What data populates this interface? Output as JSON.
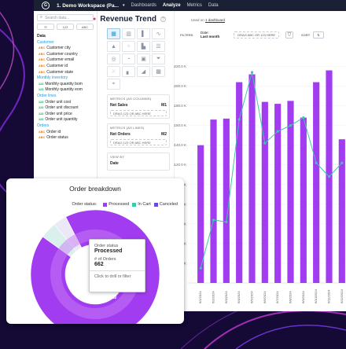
{
  "topbar": {
    "workspace": "1. Demo Workspace (Pa...",
    "nav": [
      "Dashboards",
      "Analyze",
      "Metrics",
      "Data"
    ],
    "active": "Analyze"
  },
  "sidebar": {
    "search_placeholder": "Search data...",
    "type_buttons": [
      "123",
      "ABC"
    ],
    "items": [
      {
        "kind": "top",
        "label": "Data"
      },
      {
        "kind": "grp",
        "label": "Customer"
      },
      {
        "kind": "t",
        "label": "Customer city"
      },
      {
        "kind": "t",
        "label": "Customer country"
      },
      {
        "kind": "t",
        "label": "Customer email"
      },
      {
        "kind": "t",
        "label": "Customer id"
      },
      {
        "kind": "t",
        "label": "Customer state"
      },
      {
        "kind": "grp",
        "label": "Monthly inventory"
      },
      {
        "kind": "n",
        "label": "Monthly quantity bom"
      },
      {
        "kind": "n",
        "label": "Monthly quantity eom"
      },
      {
        "kind": "grp",
        "label": "Order lines"
      },
      {
        "kind": "n",
        "label": "Order unit cost"
      },
      {
        "kind": "n",
        "label": "Order unit discount"
      },
      {
        "kind": "n",
        "label": "Order unit price"
      },
      {
        "kind": "n",
        "label": "Order unit quantity"
      },
      {
        "kind": "grp",
        "label": "Orders"
      },
      {
        "kind": "t",
        "label": "Order id"
      },
      {
        "kind": "t",
        "label": "Order status"
      }
    ]
  },
  "panel": {
    "metrics_columns_header": "METRICS (AS COLUMNS)",
    "metric_1": "Net Sales",
    "metric_1_tag": "M1",
    "metrics_lines_header": "METRICS (AS LINES)",
    "metric_2": "Net Orders",
    "metric_2_tag": "M2",
    "drag_text": "DRAG 123 OR ABC HERE",
    "view_by_header": "VIEW BY",
    "view_by_item": "Date"
  },
  "insight": {
    "title": "Revenue Trend",
    "used_on_prefix": "Used on",
    "used_on_link": "1 dashboard",
    "filters_label": "FILTERS",
    "date_label": "Date:",
    "date_value": "Last month",
    "drop_text": "DRAG ABC OR 123 HERE",
    "sort_label": "SORT"
  },
  "chart_data": {
    "type": "bar",
    "title": "",
    "y_ticks": [
      "$220.0 K",
      "$200.0 K",
      "$180.0 K",
      "$160.0 K",
      "$140.0 K",
      "$120.0 K",
      "$100.0 K",
      "$80.0 K",
      "$60.0 K",
      "$40.0 K",
      "$20.0 K"
    ],
    "ylim": [
      0,
      230
    ],
    "categories": [
      "6/1/2024",
      "6/2/2024",
      "6/3/2024",
      "6/4/2024",
      "6/5/2024",
      "6/6/2024",
      "6/7/2024",
      "6/8/2024",
      "6/9/2024",
      "6/10/2024",
      "6/11/2024",
      "6/12/2024"
    ],
    "series": [
      {
        "name": "Net Sales",
        "type": "bar",
        "color": "#a23cf0",
        "values": [
          140,
          166,
          167,
          204,
          212,
          184,
          182,
          185,
          168,
          204,
          216,
          146
        ]
      },
      {
        "name": "Net Orders",
        "type": "line",
        "color": "#3ec6ae",
        "values": [
          15,
          64,
          62,
          166,
          214,
          142,
          154,
          160,
          168,
          122,
          108,
          122
        ]
      }
    ]
  },
  "donut_card": {
    "title": "Order breakdown",
    "legend_label": "Order status:",
    "legend": [
      {
        "name": "Processed",
        "color": "#a23cf0"
      },
      {
        "name": "In Cart",
        "color": "#3ec6ae"
      },
      {
        "name": "Canceled",
        "color": "#6a4bd8"
      }
    ],
    "slices": [
      {
        "name": "Processed",
        "value": 662,
        "color": "#a23cf0"
      },
      {
        "name": "In Cart",
        "value": 30,
        "color": "#d9f0ec"
      },
      {
        "name": "Canceled",
        "value": 24,
        "color": "#ece8f8"
      }
    ],
    "slice_label": "662",
    "tooltip": {
      "k1": "Order status",
      "v1": "Processed",
      "k2": "# of Orders",
      "v2": "662",
      "cta": "Click to drill or filter"
    }
  }
}
